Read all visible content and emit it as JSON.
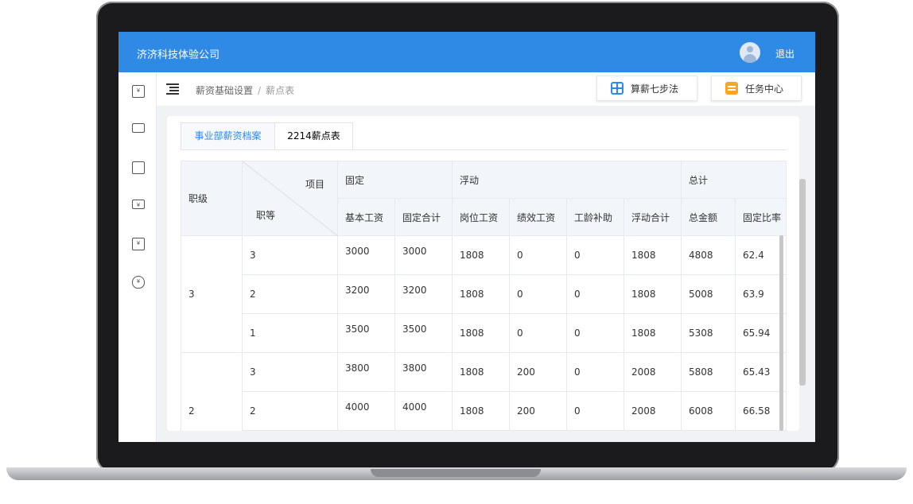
{
  "topbar": {
    "company": "济济科技体验公司",
    "logout_label": "退出"
  },
  "breadcrumb": {
    "items": [
      "薪资基础设置",
      "薪点表"
    ],
    "separator": "/"
  },
  "header_buttons": {
    "calc": "算薪七步法",
    "tasks": "任务中心"
  },
  "tabs": [
    {
      "label": "事业部薪资档案",
      "active": true
    },
    {
      "label": "2214薪点表",
      "active": false
    }
  ],
  "table": {
    "corner": {
      "top": "项目",
      "bottom": "职等"
    },
    "level_header": "职级",
    "groups": [
      "固定",
      "浮动",
      "总计"
    ],
    "columns": [
      "基本工资",
      "固定合计",
      "岗位工资",
      "绩效工资",
      "工龄补助",
      "浮动合计",
      "总金额",
      "固定比率"
    ],
    "rows": [
      {
        "level": "3",
        "grade": "3",
        "values": [
          "3000",
          "3000",
          "1808",
          "0",
          "0",
          "1808",
          "4808",
          "62.4"
        ]
      },
      {
        "level": "3",
        "grade": "2",
        "values": [
          "3200",
          "3200",
          "1808",
          "0",
          "0",
          "1808",
          "5008",
          "63.9"
        ]
      },
      {
        "level": "3",
        "grade": "1",
        "values": [
          "3500",
          "3500",
          "1808",
          "0",
          "0",
          "1808",
          "5308",
          "65.94"
        ]
      },
      {
        "level": "2",
        "grade": "3",
        "values": [
          "3800",
          "3800",
          "1808",
          "200",
          "0",
          "2008",
          "5808",
          "65.43"
        ]
      },
      {
        "level": "2",
        "grade": "2",
        "values": [
          "4000",
          "4000",
          "1808",
          "200",
          "0",
          "2008",
          "6008",
          "66.58"
        ]
      },
      {
        "level": "2",
        "grade": "",
        "values": [
          "",
          "",
          "",
          "",
          "",
          "",
          "",
          ""
        ]
      }
    ],
    "merged_levels": [
      "3",
      "2"
    ]
  },
  "sidebar_icons": [
    "calendar-yen-icon",
    "monitor-chart-icon",
    "document-search-icon",
    "ticket-yen-icon",
    "receipt-yen-icon",
    "shield-yen-icon"
  ],
  "colors": {
    "brand": "#2f8ae5",
    "task_icon": "#f5a623"
  }
}
